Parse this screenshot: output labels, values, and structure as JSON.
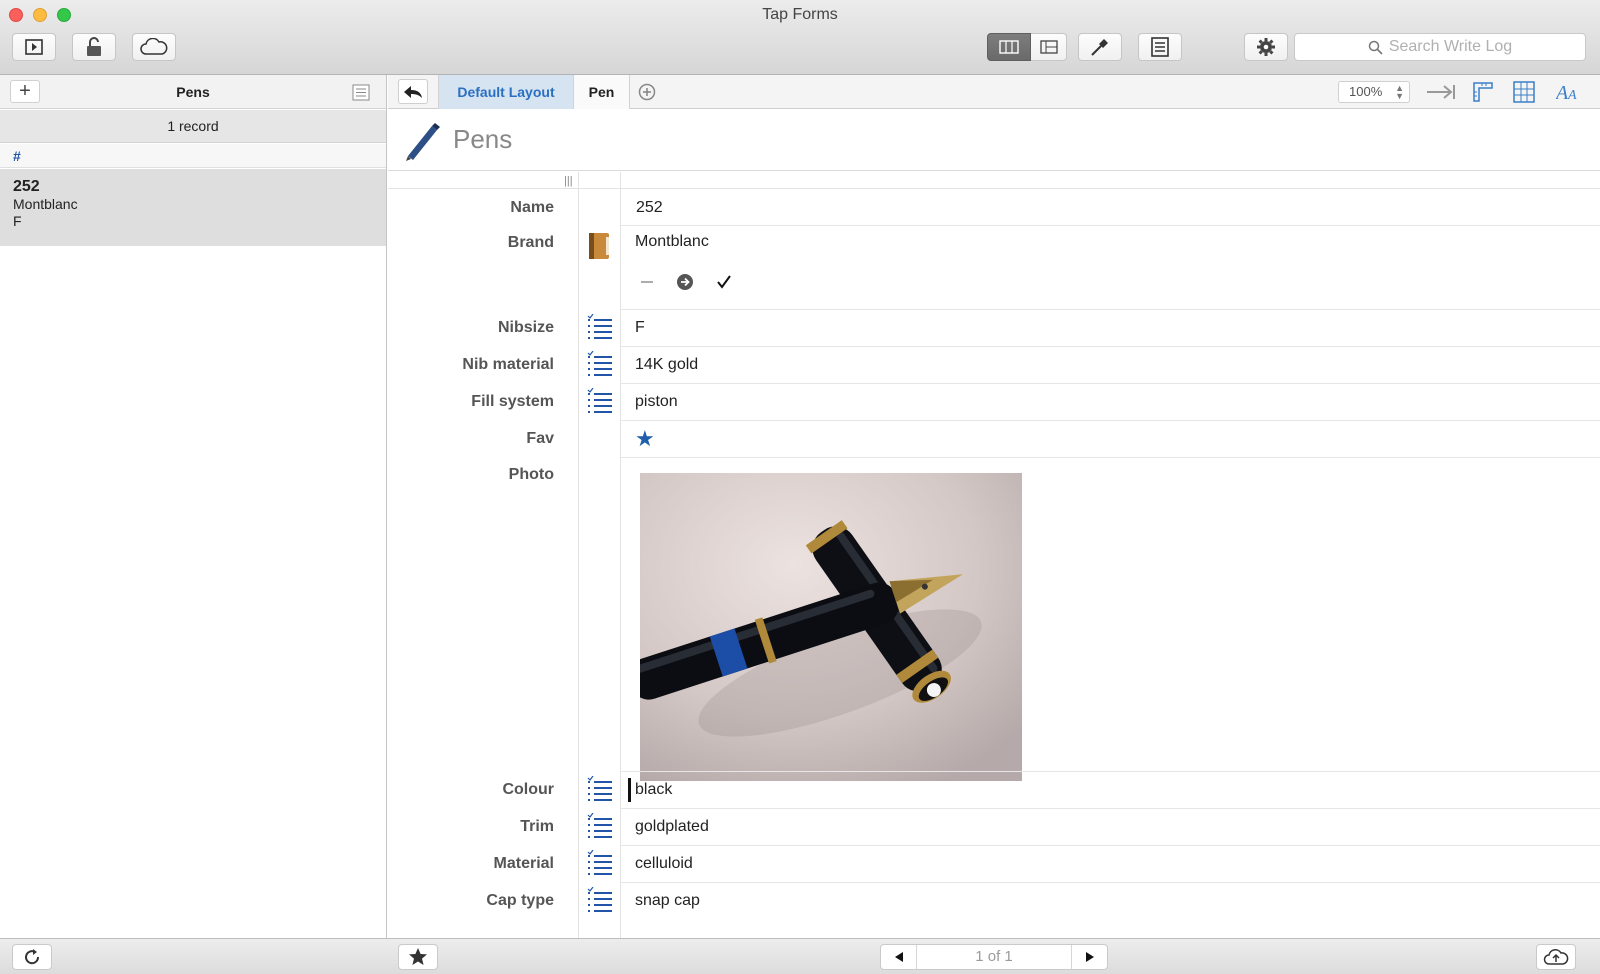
{
  "window": {
    "title": "Tap Forms"
  },
  "toolbar": {
    "search_placeholder": "Search Write Log"
  },
  "sidebar": {
    "title": "Pens",
    "add_label": "+",
    "record_count": "1 record",
    "section_header": "#",
    "records": [
      {
        "title": "252",
        "line1": "Montblanc",
        "line2": "F"
      }
    ]
  },
  "tabs": {
    "items": [
      {
        "label": "Default Layout",
        "active": true
      },
      {
        "label": "Pen",
        "active": false
      }
    ],
    "zoom": "100%"
  },
  "form": {
    "title": "Pens",
    "fields": {
      "name": {
        "label": "Name",
        "value": "252"
      },
      "brand": {
        "label": "Brand",
        "value": "Montblanc"
      },
      "nibsize": {
        "label": "Nibsize",
        "value": "F"
      },
      "nib_material": {
        "label": "Nib material",
        "value": "14K gold"
      },
      "fill_system": {
        "label": "Fill system",
        "value": "piston"
      },
      "fav": {
        "label": "Fav",
        "value": "★"
      },
      "photo": {
        "label": "Photo"
      },
      "colour": {
        "label": "Colour",
        "value": "black"
      },
      "trim": {
        "label": "Trim",
        "value": "goldplated"
      },
      "material": {
        "label": "Material",
        "value": "celluloid"
      },
      "cap_type": {
        "label": "Cap type",
        "value": "snap cap"
      }
    }
  },
  "pager": {
    "label": "1 of 1"
  },
  "colors": {
    "accent": "#2a70c0",
    "list_icon": "#2155a8",
    "star": "#1f5ea8"
  }
}
